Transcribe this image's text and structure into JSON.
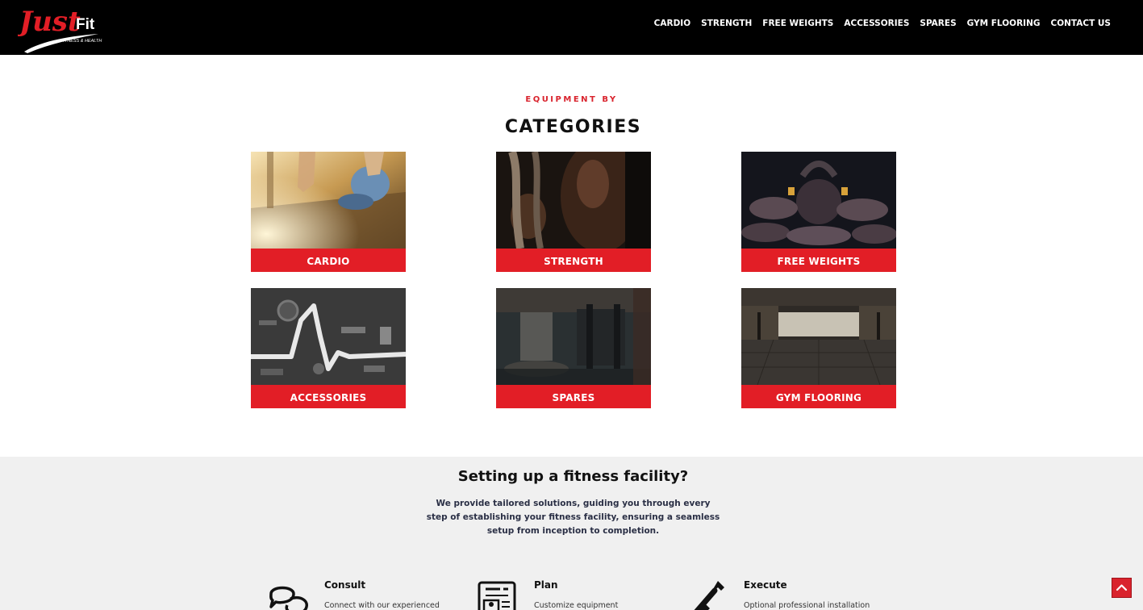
{
  "brand": {
    "logo_main": "Just",
    "logo_fit": "Fit",
    "logo_tagline": "FITNESS & HEALTH",
    "accent": "#e21e26"
  },
  "nav": {
    "items": [
      "CARDIO",
      "STRENGTH",
      "FREE WEIGHTS",
      "ACCESSORIES",
      "SPARES",
      "GYM FLOORING",
      "CONTACT US"
    ]
  },
  "categories": {
    "eyebrow": "EQUIPMENT BY",
    "title": "CATEGORIES",
    "items": [
      {
        "label": "CARDIO",
        "image": "treadmill-running-photo"
      },
      {
        "label": "STRENGTH",
        "image": "battle-ropes-photo"
      },
      {
        "label": "FREE WEIGHTS",
        "image": "kettlebell-plates-photo"
      },
      {
        "label": "ACCESSORIES",
        "image": "rope-dumbbells-flatlay-photo"
      },
      {
        "label": "SPARES",
        "image": "gym-interior-blurred-photo"
      },
      {
        "label": "GYM FLOORING",
        "image": "empty-gym-floor-photo"
      }
    ]
  },
  "setup": {
    "title": "Setting up a fitness facility?",
    "description": "We provide tailored solutions, guiding you through every step of establishing your fitness facility, ensuring a seamless setup from inception to completion.",
    "steps": [
      {
        "title": "Consult",
        "desc": "Connect with our experienced",
        "icon": "chat-bubbles-icon"
      },
      {
        "title": "Plan",
        "desc": "Customize equipment",
        "icon": "newsletter-plan-icon"
      },
      {
        "title": "Execute",
        "desc": "Optional professional installation",
        "icon": "tools-icon"
      }
    ]
  },
  "back_to_top": {
    "icon": "chevron-up-icon"
  }
}
